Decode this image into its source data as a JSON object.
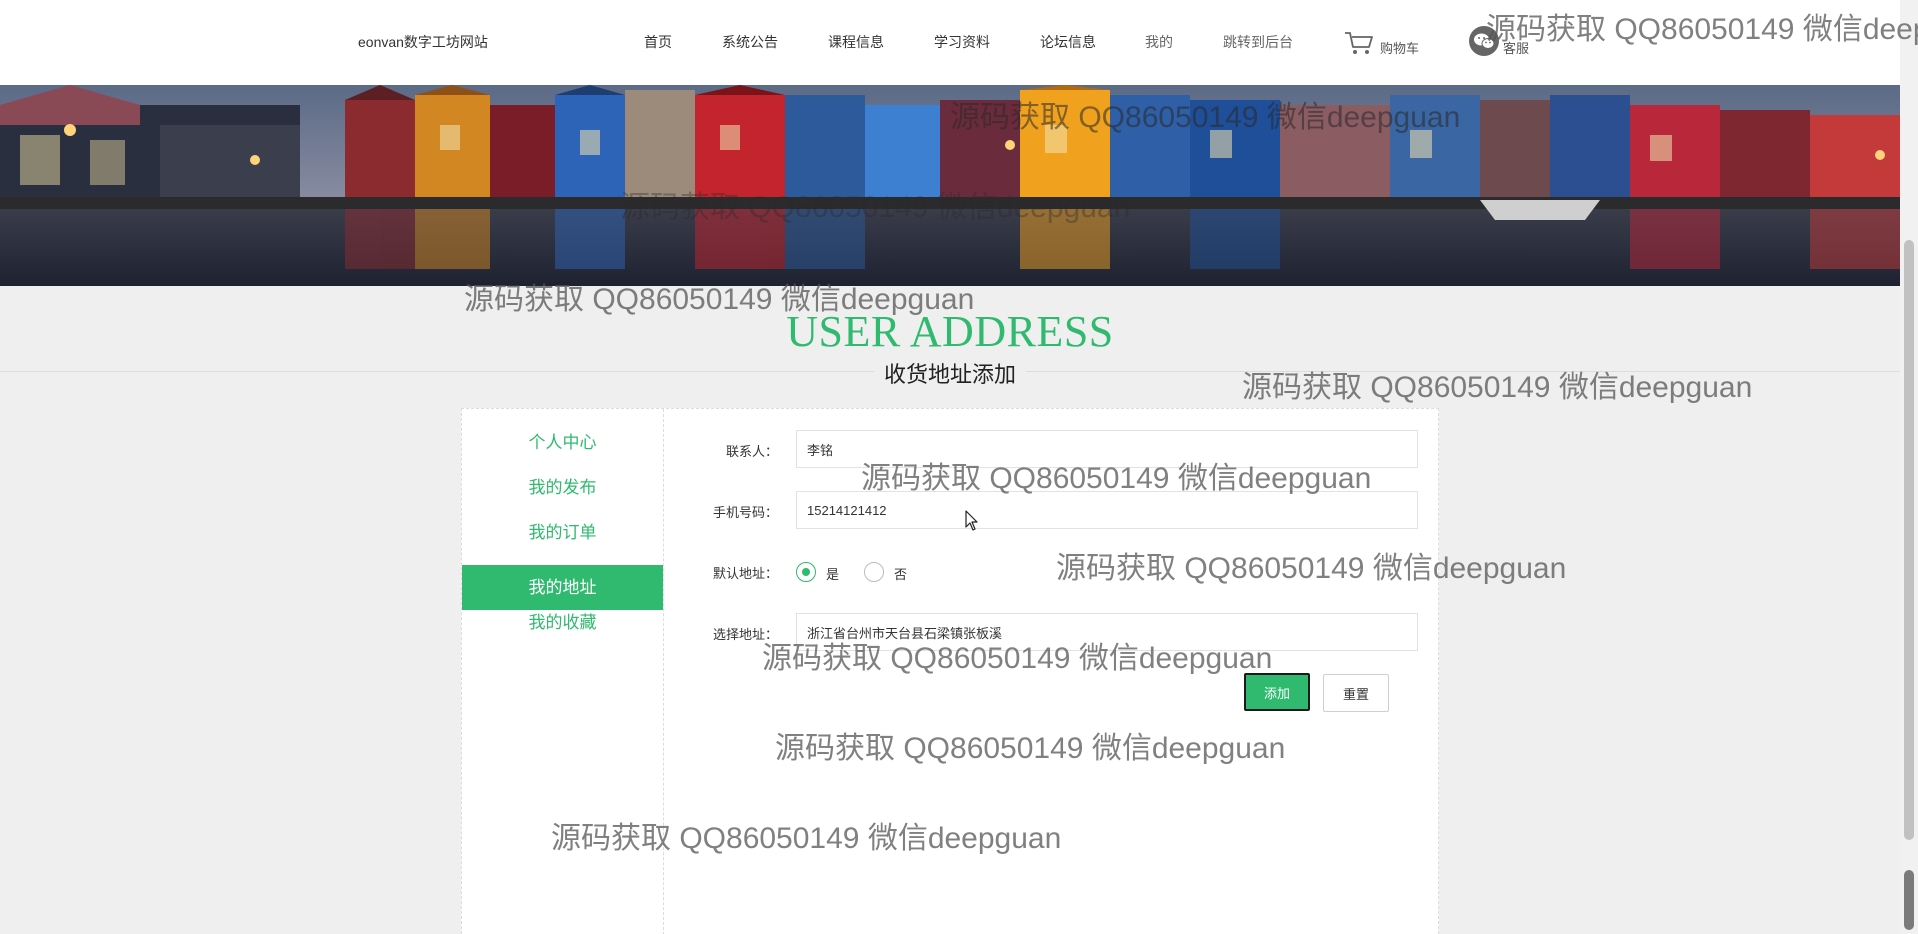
{
  "header": {
    "site_name": "eonvan数字工坊网站",
    "nav": [
      {
        "label": "首页"
      },
      {
        "label": "系统公告"
      },
      {
        "label": "课程信息"
      },
      {
        "label": "学习资料"
      },
      {
        "label": "论坛信息"
      },
      {
        "label": "我的"
      },
      {
        "label": "跳转到后台"
      }
    ],
    "cart_label": "购物车",
    "service_label": "客服"
  },
  "section": {
    "title_en": "USER ADDRESS",
    "title_cn": "收货地址添加"
  },
  "sidebar": {
    "items": [
      {
        "label": "个人中心",
        "active": false
      },
      {
        "label": "我的发布",
        "active": false
      },
      {
        "label": "我的订单",
        "active": false
      },
      {
        "label": "我的地址",
        "active": true
      },
      {
        "label": "我的收藏",
        "active": false
      }
    ]
  },
  "form": {
    "contact_label": "联系人：",
    "contact_value": "李铭",
    "phone_label": "手机号码：",
    "phone_value": "15214121412",
    "default_label": "默认地址：",
    "default_yes": "是",
    "default_no": "否",
    "default_selected": "是",
    "address_label": "选择地址：",
    "address_value": "浙江省台州市天台县石梁镇张板溪",
    "add_button": "添加",
    "reset_button": "重置"
  },
  "watermark": {
    "text": "源码获取 QQ86050149 微信deepguan"
  },
  "colors": {
    "accent": "#2fba6f",
    "background": "#efefef"
  }
}
